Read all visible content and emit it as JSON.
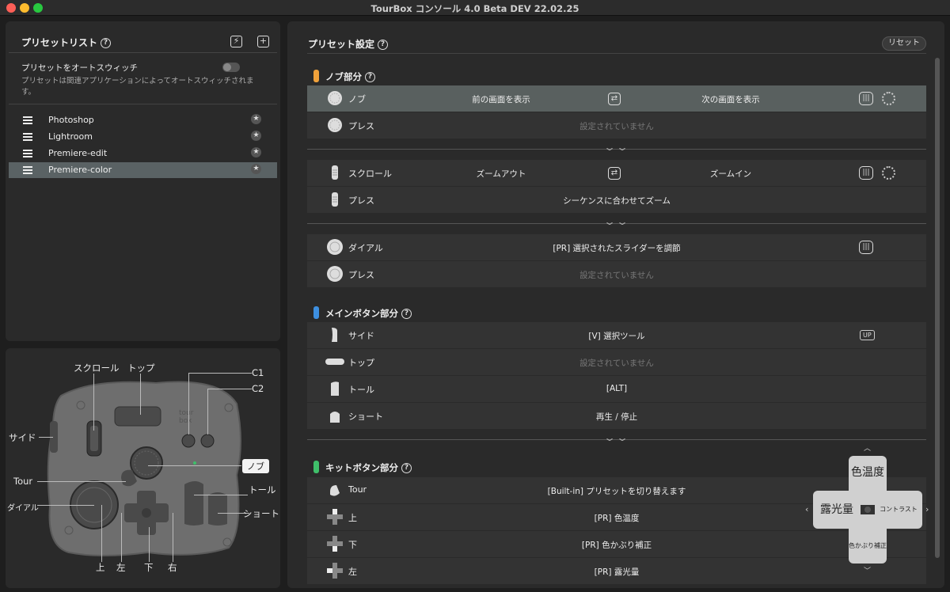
{
  "window": {
    "title": "TourBox コンソール 4.0 Beta DEV 22.02.25"
  },
  "preset_list": {
    "title": "プリセットリスト",
    "help": "?",
    "auto_switch_label": "プリセットをオートスウィッチ",
    "auto_switch_desc": "プリセットは関連アプリケーションによってオートスウィッチされます。",
    "items": [
      {
        "label": "Photoshop"
      },
      {
        "label": "Lightroom"
      },
      {
        "label": "Premiere-edit"
      },
      {
        "label": "Premiere-color"
      }
    ]
  },
  "device": {
    "labels": {
      "scroll": "スクロール",
      "top": "トップ",
      "c1": "C1",
      "c2": "C2",
      "side": "サイド",
      "knob": "ノブ",
      "tour": "Tour",
      "tall": "トール",
      "dial": "ダイアル",
      "short": "ショート",
      "up": "上",
      "left": "左",
      "down": "下",
      "right": "右"
    }
  },
  "preset_settings": {
    "title": "プリセット設定",
    "help": "?",
    "reset_label": "リセット",
    "knob_section": {
      "title": "ノブ部分",
      "color": "#f0a13a",
      "rows": [
        {
          "name": "ノブ",
          "a": "前の画面を表示",
          "b": "次の画面を表示"
        },
        {
          "name": "プレス",
          "value": "設定されていません"
        }
      ]
    },
    "scroll_section": {
      "rows": [
        {
          "name": "スクロール",
          "a": "ズームアウト",
          "b": "ズームイン"
        },
        {
          "name": "プレス",
          "value": "シーケンスに合わせてズーム"
        }
      ]
    },
    "dial_section": {
      "rows": [
        {
          "name": "ダイアル",
          "value": "[PR] 選択されたスライダーを調節"
        },
        {
          "name": "プレス",
          "value": "設定されていません"
        }
      ]
    },
    "main_section": {
      "title": "メインボタン部分",
      "color": "#3d8fe0",
      "rows": [
        {
          "name": "サイド",
          "value": "[V] 選択ツール",
          "badge": "UP"
        },
        {
          "name": "トップ",
          "value": "設定されていません"
        },
        {
          "name": "トール",
          "value": "[ALT]"
        },
        {
          "name": "ショート",
          "value": "再生 / 停止"
        }
      ]
    },
    "kit_section": {
      "title": "キットボタン部分",
      "color": "#3fbf6a",
      "rows": [
        {
          "name": "Tour",
          "value": "[Built-in] プリセットを切り替えます"
        },
        {
          "name": "上",
          "value": "[PR] 色温度"
        },
        {
          "name": "下",
          "value": "[PR] 色かぶり補正"
        },
        {
          "name": "左",
          "value": "[PR] 露光量"
        }
      ]
    },
    "dpad_overlay": {
      "top": "色温度",
      "left": "露光量",
      "right": "コントラスト",
      "bottom": "色かぶり補正"
    }
  }
}
